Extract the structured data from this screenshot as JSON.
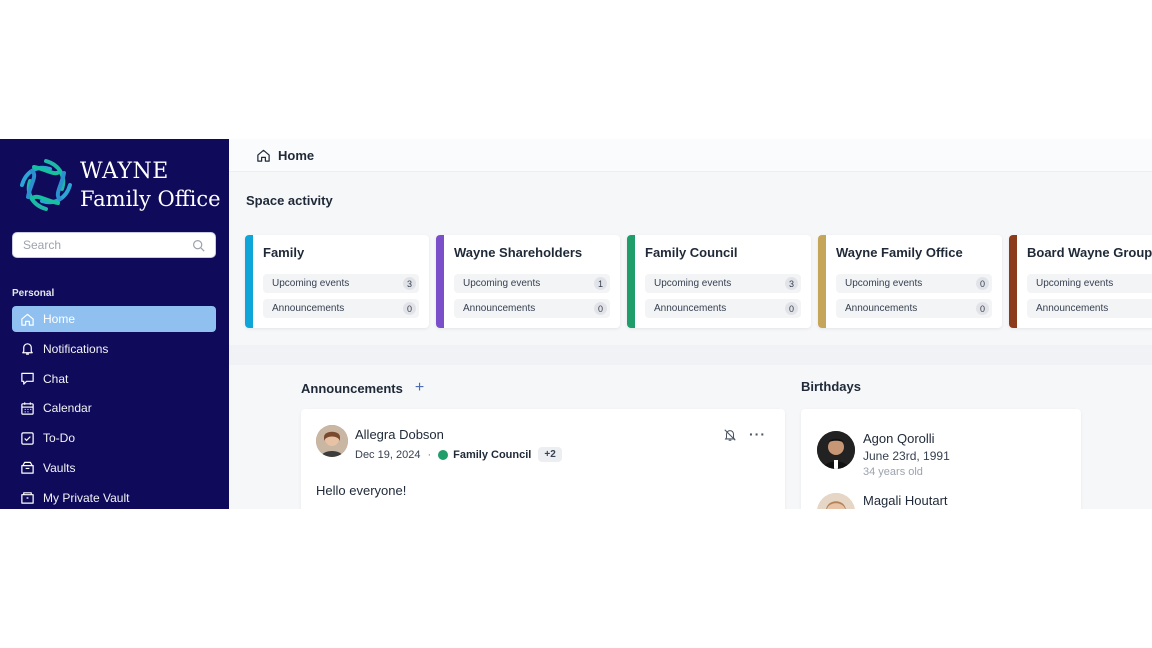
{
  "sidebar": {
    "brand": {
      "line1": "WAYNE",
      "line2": "Family Office"
    },
    "search_placeholder": "Search",
    "section_label": "Personal",
    "items": [
      {
        "label": "Home",
        "icon": "home-icon",
        "active": true
      },
      {
        "label": "Notifications",
        "icon": "bell-icon"
      },
      {
        "label": "Chat",
        "icon": "chat-icon"
      },
      {
        "label": "Calendar",
        "icon": "calendar-icon"
      },
      {
        "label": "To-Do",
        "icon": "checkbox-icon"
      },
      {
        "label": "Vaults",
        "icon": "vault-icon"
      },
      {
        "label": "My Private Vault",
        "icon": "private-vault-icon"
      }
    ],
    "colors": {
      "background": "#0f0a5a",
      "active": "#8fc0f0"
    }
  },
  "header": {
    "breadcrumb": "Home"
  },
  "space_activity": {
    "title": "Space activity",
    "cards": [
      {
        "name": "Family",
        "color": "#0ea5d9",
        "upcoming_label": "Upcoming events",
        "upcoming": "3",
        "announcements_label": "Announcements",
        "announcements": "0"
      },
      {
        "name": "Wayne Shareholders",
        "color": "#7b4fc9",
        "upcoming_label": "Upcoming events",
        "upcoming": "1",
        "announcements_label": "Announcements",
        "announcements": "0"
      },
      {
        "name": "Family Council",
        "color": "#1f9d6b",
        "upcoming_label": "Upcoming events",
        "upcoming": "3",
        "announcements_label": "Announcements",
        "announcements": "0"
      },
      {
        "name": "Wayne Family Office",
        "color": "#c4a55a",
        "upcoming_label": "Upcoming events",
        "upcoming": "0",
        "announcements_label": "Announcements",
        "announcements": "0"
      },
      {
        "name": "Board Wayne Group",
        "color": "#8b3a1a",
        "upcoming_label": "Upcoming events",
        "upcoming": "",
        "announcements_label": "Announcements",
        "announcements": ""
      }
    ]
  },
  "announcements": {
    "title": "Announcements",
    "add_label": "+",
    "post": {
      "author": "Allegra Dobson",
      "date": "Dec 19, 2024",
      "separator": "·",
      "space": "Family Council",
      "more_spaces": "+2",
      "options_label": "···",
      "text": "Hello everyone!"
    }
  },
  "birthdays": {
    "title": "Birthdays",
    "people": [
      {
        "name": "Agon Qorolli",
        "date": "June 23rd, 1991",
        "age": "34 years old"
      },
      {
        "name": "Magali Houtart",
        "date": "",
        "age": ""
      }
    ]
  }
}
